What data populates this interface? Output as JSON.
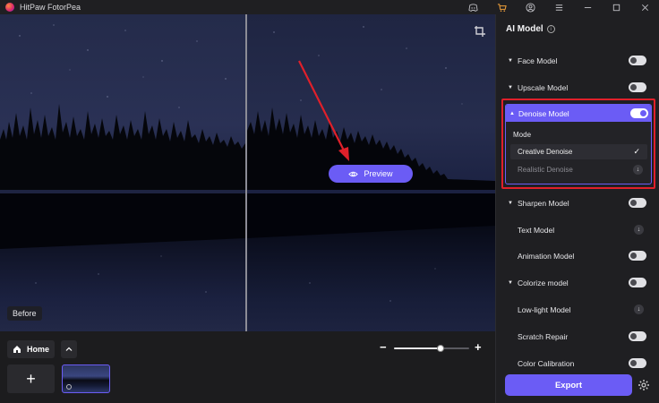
{
  "app": {
    "title": "HitPaw FotorPea"
  },
  "canvas": {
    "before_label": "Before",
    "preview_label": "Preview"
  },
  "bottom": {
    "home_label": "Home",
    "add_symbol": "+",
    "zoom_minus": "−",
    "zoom_plus": "+",
    "zoom_level": 0.62
  },
  "panel": {
    "title": "AI Model",
    "models": [
      {
        "label": "Face Model",
        "caret": "▼",
        "control": "toggle",
        "on": false
      },
      {
        "label": "Upscale Model",
        "caret": "▼",
        "control": "toggle",
        "on": false
      },
      {
        "label": "Sharpen Model",
        "caret": "▼",
        "control": "toggle",
        "on": false
      },
      {
        "label": "Text Model",
        "caret": "",
        "control": "download"
      },
      {
        "label": "Animation Model",
        "caret": "",
        "control": "toggle",
        "on": false
      },
      {
        "label": "Colorize model",
        "caret": "▼",
        "control": "toggle",
        "on": false
      },
      {
        "label": "Low-light Model",
        "caret": "",
        "control": "download"
      },
      {
        "label": "Scratch Repair",
        "caret": "",
        "control": "toggle",
        "on": false
      },
      {
        "label": "Color Calibration",
        "caret": "",
        "control": "toggle",
        "on": false
      }
    ],
    "denoise": {
      "label": "Denoise Model",
      "caret": "▲",
      "on": true,
      "mode_label": "Mode",
      "options": [
        {
          "label": "Creative Denoise",
          "selected": true
        },
        {
          "label": "Realistic Denoise",
          "selected": false
        }
      ]
    },
    "export_label": "Export"
  },
  "colors": {
    "accent": "#6b5cf5",
    "highlight_border": "#e0202a",
    "arrow": "#e0202a"
  }
}
